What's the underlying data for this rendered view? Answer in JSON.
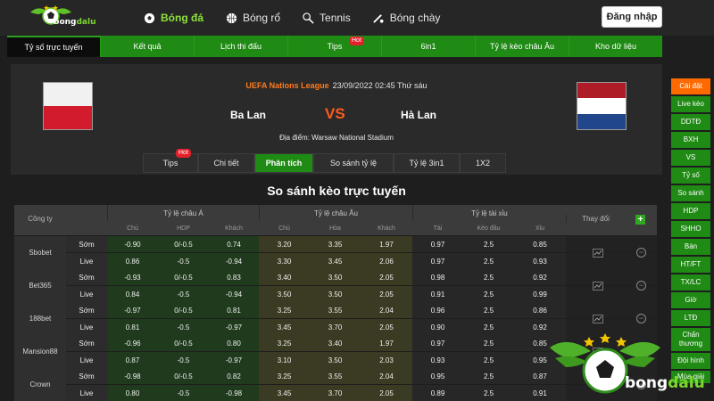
{
  "header": {
    "logo_text_1": "bong",
    "logo_text_2": "dalu",
    "nav": [
      {
        "label": "Bóng đá",
        "icon": "soccer-ball-icon",
        "active": true
      },
      {
        "label": "Bóng rổ",
        "icon": "basketball-icon",
        "active": false
      },
      {
        "label": "Tennis",
        "icon": "tennis-icon",
        "active": false
      },
      {
        "label": "Bóng chày",
        "icon": "baseball-icon",
        "active": false
      }
    ],
    "login_label": "Đăng nhập"
  },
  "main_nav": {
    "tabs": [
      "Tỷ số trực tuyến",
      "Kết quả",
      "Lịch thi đấu",
      "Tips",
      "6in1",
      "Tỷ lệ kèo châu Âu",
      "Kho dữ liệu"
    ],
    "hot_label": "Hot"
  },
  "match": {
    "league": "UEFA Nations League",
    "datetime": "23/09/2022 02:45 Thứ sáu",
    "home": "Ba Lan",
    "away": "Hà Lan",
    "vs": "VS",
    "venue": "Địa điểm: Warsaw National Stadium",
    "subtabs": [
      "Tips",
      "Chi tiết",
      "Phân tích",
      "So sánh tỷ lệ",
      "Tỷ lệ 3in1",
      "1X2"
    ],
    "hot_label": "Hot",
    "colors": {
      "poland_white": "#f1f1f1",
      "poland_red": "#d31b2e",
      "nl_red": "#ae1c28",
      "nl_white": "#ffffff",
      "nl_blue": "#21468b"
    }
  },
  "compare": {
    "title": "So sánh kèo trực tuyến",
    "header": {
      "company": "Công ty",
      "asia": "Tỷ lệ châu Á",
      "eu": "Tỷ lệ châu Âu",
      "ou": "Tỷ lệ tài xỉu",
      "change": "Thay đổi",
      "asia_sub": [
        "Chủ",
        "HDP",
        "Khách"
      ],
      "eu_sub": [
        "Chủ",
        "Hòa",
        "Khách"
      ],
      "ou_sub": [
        "Tài",
        "Kèo đầu",
        "Xỉu"
      ]
    },
    "plus_label": "+",
    "minus_label": "−",
    "bookies": [
      {
        "name": "Sbobet",
        "rows": [
          {
            "label": "Sớm",
            "values": [
              "-0.90",
              "0/-0.5",
              "0.74",
              "3.20",
              "3.35",
              "1.97",
              "0.97",
              "2.5",
              "0.85"
            ]
          },
          {
            "label": "Live",
            "values": [
              "0.86",
              "-0.5",
              "-0.94",
              "3.30",
              "3.45",
              "2.06",
              "0.97",
              "2.5",
              "0.93"
            ]
          }
        ]
      },
      {
        "name": "Bet365",
        "rows": [
          {
            "label": "Sớm",
            "values": [
              "-0.93",
              "0/-0.5",
              "0.83",
              "3.40",
              "3.50",
              "2.05",
              "0.98",
              "2.5",
              "0.92"
            ]
          },
          {
            "label": "Live",
            "values": [
              "0.84",
              "-0.5",
              "-0.94",
              "3.50",
              "3.50",
              "2.05",
              "0.91",
              "2.5",
              "0.99"
            ]
          }
        ]
      },
      {
        "name": "188bet",
        "rows": [
          {
            "label": "Sớm",
            "values": [
              "-0.97",
              "0/-0.5",
              "0.81",
              "3.25",
              "3.55",
              "2.04",
              "0.96",
              "2.5",
              "0.86"
            ]
          },
          {
            "label": "Live",
            "values": [
              "0.81",
              "-0.5",
              "-0.97",
              "3.45",
              "3.70",
              "2.05",
              "0.90",
              "2.5",
              "0.92"
            ]
          }
        ]
      },
      {
        "name": "Mansion88",
        "rows": [
          {
            "label": "Sớm",
            "values": [
              "-0.96",
              "0/-0.5",
              "0.80",
              "3.25",
              "3.40",
              "1.97",
              "0.97",
              "2.5",
              "0.85"
            ]
          },
          {
            "label": "Live",
            "values": [
              "0.87",
              "-0.5",
              "-0.97",
              "3.10",
              "3.50",
              "2.03",
              "0.93",
              "2.5",
              "0.95"
            ]
          }
        ]
      },
      {
        "name": "Crown",
        "rows": [
          {
            "label": "Sớm",
            "values": [
              "-0.98",
              "0/-0.5",
              "0.82",
              "3.25",
              "3.55",
              "2.04",
              "0.95",
              "2.5",
              "0.87"
            ]
          },
          {
            "label": "Live",
            "values": [
              "0.80",
              "-0.5",
              "-0.98",
              "3.45",
              "3.70",
              "2.05",
              "0.89",
              "2.5",
              "0.91"
            ]
          }
        ]
      }
    ]
  },
  "sidebar": {
    "items": [
      "Cài đặt",
      "Live kèo",
      "DDTĐ",
      "BXH",
      "VS",
      "Tỷ số",
      "So sánh",
      "HDP",
      "SHHO",
      "Bàn",
      "HT/FT",
      "TX/LC",
      "Giờ",
      "LTĐ",
      "Chấn thương",
      "Đội hình",
      "Mùa giải"
    ]
  },
  "watermark": {
    "text_1": "bong",
    "text_2": "dalu"
  }
}
